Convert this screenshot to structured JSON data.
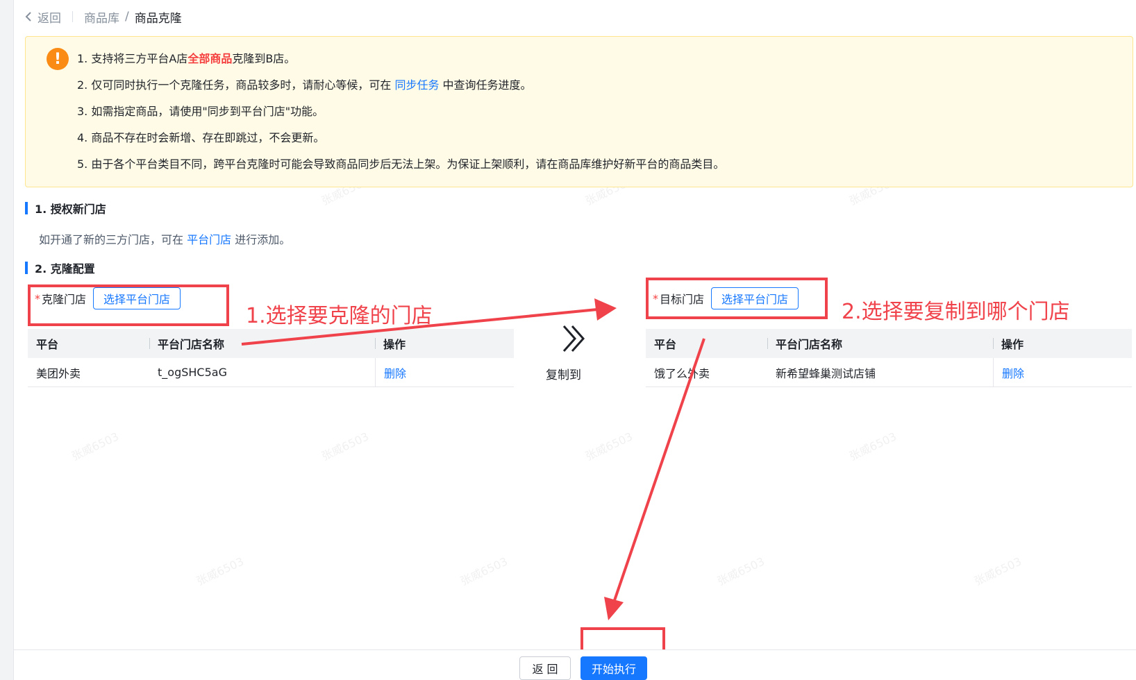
{
  "breadcrumb": {
    "back_label": "返回",
    "items": [
      "商品库",
      "商品克隆"
    ]
  },
  "notice": {
    "line1_prefix": "1. 支持将三方平台A店",
    "line1_highlight": "全部商品",
    "line1_suffix": "克隆到B店。",
    "line2_prefix": "2. 仅可同时执行一个克隆任务，商品较多时，请耐心等候，可在 ",
    "line2_link": "同步任务",
    "line2_suffix": " 中查询任务进度。",
    "line3": "3. 如需指定商品，请使用\"同步到平台门店\"功能。",
    "line4": "4. 商品不存在时会新增、存在即跳过，不会更新。",
    "line5": "5. 由于各个平台类目不同，跨平台克隆时可能会导致商品同步后无法上架。为保证上架顺利，请在商品库维护好新平台的商品类目。",
    "icon": "exclamation-icon"
  },
  "section1": {
    "title": "1. 授权新门店",
    "hint_prefix": "如开通了新的三方门店，可在 ",
    "hint_link": "平台门店",
    "hint_suffix": " 进行添加。"
  },
  "section2": {
    "title": "2. 克隆配置",
    "copy_label": "复制到",
    "source": {
      "required_mark": "*",
      "label": "克隆门店",
      "select_button": "选择平台门店",
      "columns": [
        "平台",
        "平台门店名称",
        "操作"
      ],
      "rows": [
        {
          "platform": "美团外卖",
          "store_name": "t_ogSHC5aG",
          "action": "删除"
        }
      ]
    },
    "target": {
      "required_mark": "*",
      "label": "目标门店",
      "select_button": "选择平台门店",
      "columns": [
        "平台",
        "平台门店名称",
        "操作"
      ],
      "rows": [
        {
          "platform": "饿了么外卖",
          "store_name": "新希望蜂巢测试店铺",
          "action": "删除"
        }
      ]
    }
  },
  "annotations": {
    "step1": "1.选择要克隆的门店",
    "step2": "2.选择要复制到哪个门店",
    "color": "#f0424a"
  },
  "footer": {
    "back_button": "返 回",
    "start_button": "开始执行"
  },
  "watermark": "张威6503",
  "colors": {
    "primary": "#1677ff",
    "warning_bg": "#fffbe6",
    "warning_icon": "#fa8c16",
    "danger": "#f53f3f"
  }
}
